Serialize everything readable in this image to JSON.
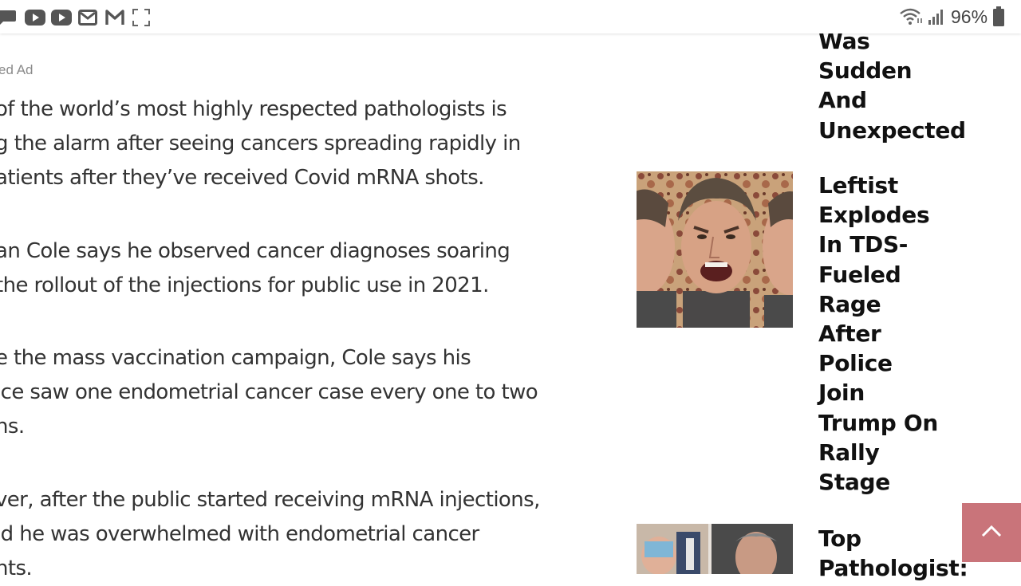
{
  "status_bar": {
    "battery_percent": "96%",
    "left_icons": [
      "chat-icon",
      "youtube-icon",
      "youtube-icon",
      "mail-icon",
      "gmail-icon",
      "fullscreen-icon"
    ],
    "right_icons": [
      "wifi-icon",
      "signal-icon",
      "battery-icon"
    ]
  },
  "article": {
    "ad_label": "ed Ad",
    "paragraphs": [
      {
        "lines": [
          "of the world’s most highly respected pathologists is",
          "g the alarm after seeing cancers spreading rapidly in",
          "atients after they’ve received Covid mRNA shots."
        ]
      },
      {
        "lines": [
          "an Cole says he observed cancer diagnoses soaring",
          " the rollout of the injections for public use in 2021."
        ]
      },
      {
        "lines": [
          "e the mass vaccination campaign, Cole says his",
          "ice saw one endometrial cancer case every one to two",
          "hs."
        ]
      },
      {
        "lines": [
          "ver, after the public started receiving mRNA injections,",
          "id he was overwhelmed with endometrial cancer",
          "nts."
        ]
      }
    ]
  },
  "sidebar": {
    "items": [
      {
        "title_lines": [
          "Was",
          "Sudden",
          "And",
          "Unexpected"
        ]
      },
      {
        "title_lines": [
          "Leftist",
          "Explodes",
          "In TDS-",
          "Fueled",
          "Rage",
          "After",
          "Police",
          "Join",
          "Trump On",
          "Rally",
          "Stage"
        ]
      },
      {
        "title_lines": [
          "Top",
          "Pathologist:"
        ]
      }
    ]
  },
  "colors": {
    "scroll_button": "#c9747a",
    "link_blue": "#3a7bd5",
    "body_text": "#333333"
  }
}
